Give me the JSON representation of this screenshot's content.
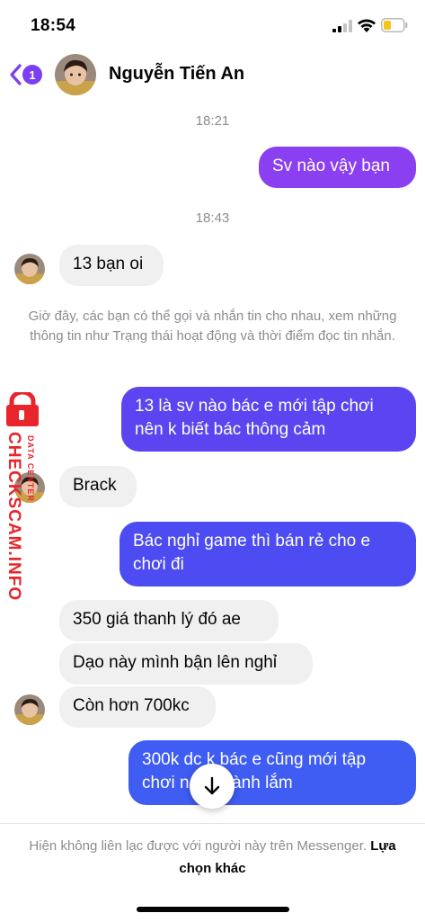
{
  "status_bar": {
    "time": "18:54"
  },
  "header": {
    "unread_count": "1",
    "contact_name": "Nguyễn Tiến An"
  },
  "timestamps": [
    "18:21",
    "18:43"
  ],
  "messages": {
    "m1": "Sv nào vậy bạn",
    "m2": "13 bạn oi",
    "m3": "13 là sv nào bác e mới tập chơi nên k biết bác thông cảm",
    "m4": "Brack",
    "m5": "Bác nghỉ game thì bán rẻ cho e chơi đi",
    "m6": "350 giá thanh lý đó ae",
    "m7": "Dạo này mình bận lên nghỉ",
    "m8": "Còn hơn 700kc",
    "m9": "300k dc k bác e cũng mới tập chơi nên k rành lắm"
  },
  "notice": "Giờ đây, các bạn có thể gọi và nhắn tin cho nhau, xem những thông tin như Trạng thái hoạt động và thời điểm đọc tin nhắn.",
  "watermark": {
    "main": "CHECKSCAM.INFO",
    "sub": "DATA CENTER"
  },
  "footer": {
    "text": "Hiện không liên lạc được với người này trên Messenger.",
    "link": "Lựa chọn khác"
  },
  "colors": {
    "accent": "#7b3ef2",
    "bubble_purple": "#8a3ff0",
    "bubble_blue": "#4c4cf2",
    "bubble_gray": "#f0f0f0",
    "watermark_red": "#e8252b"
  }
}
